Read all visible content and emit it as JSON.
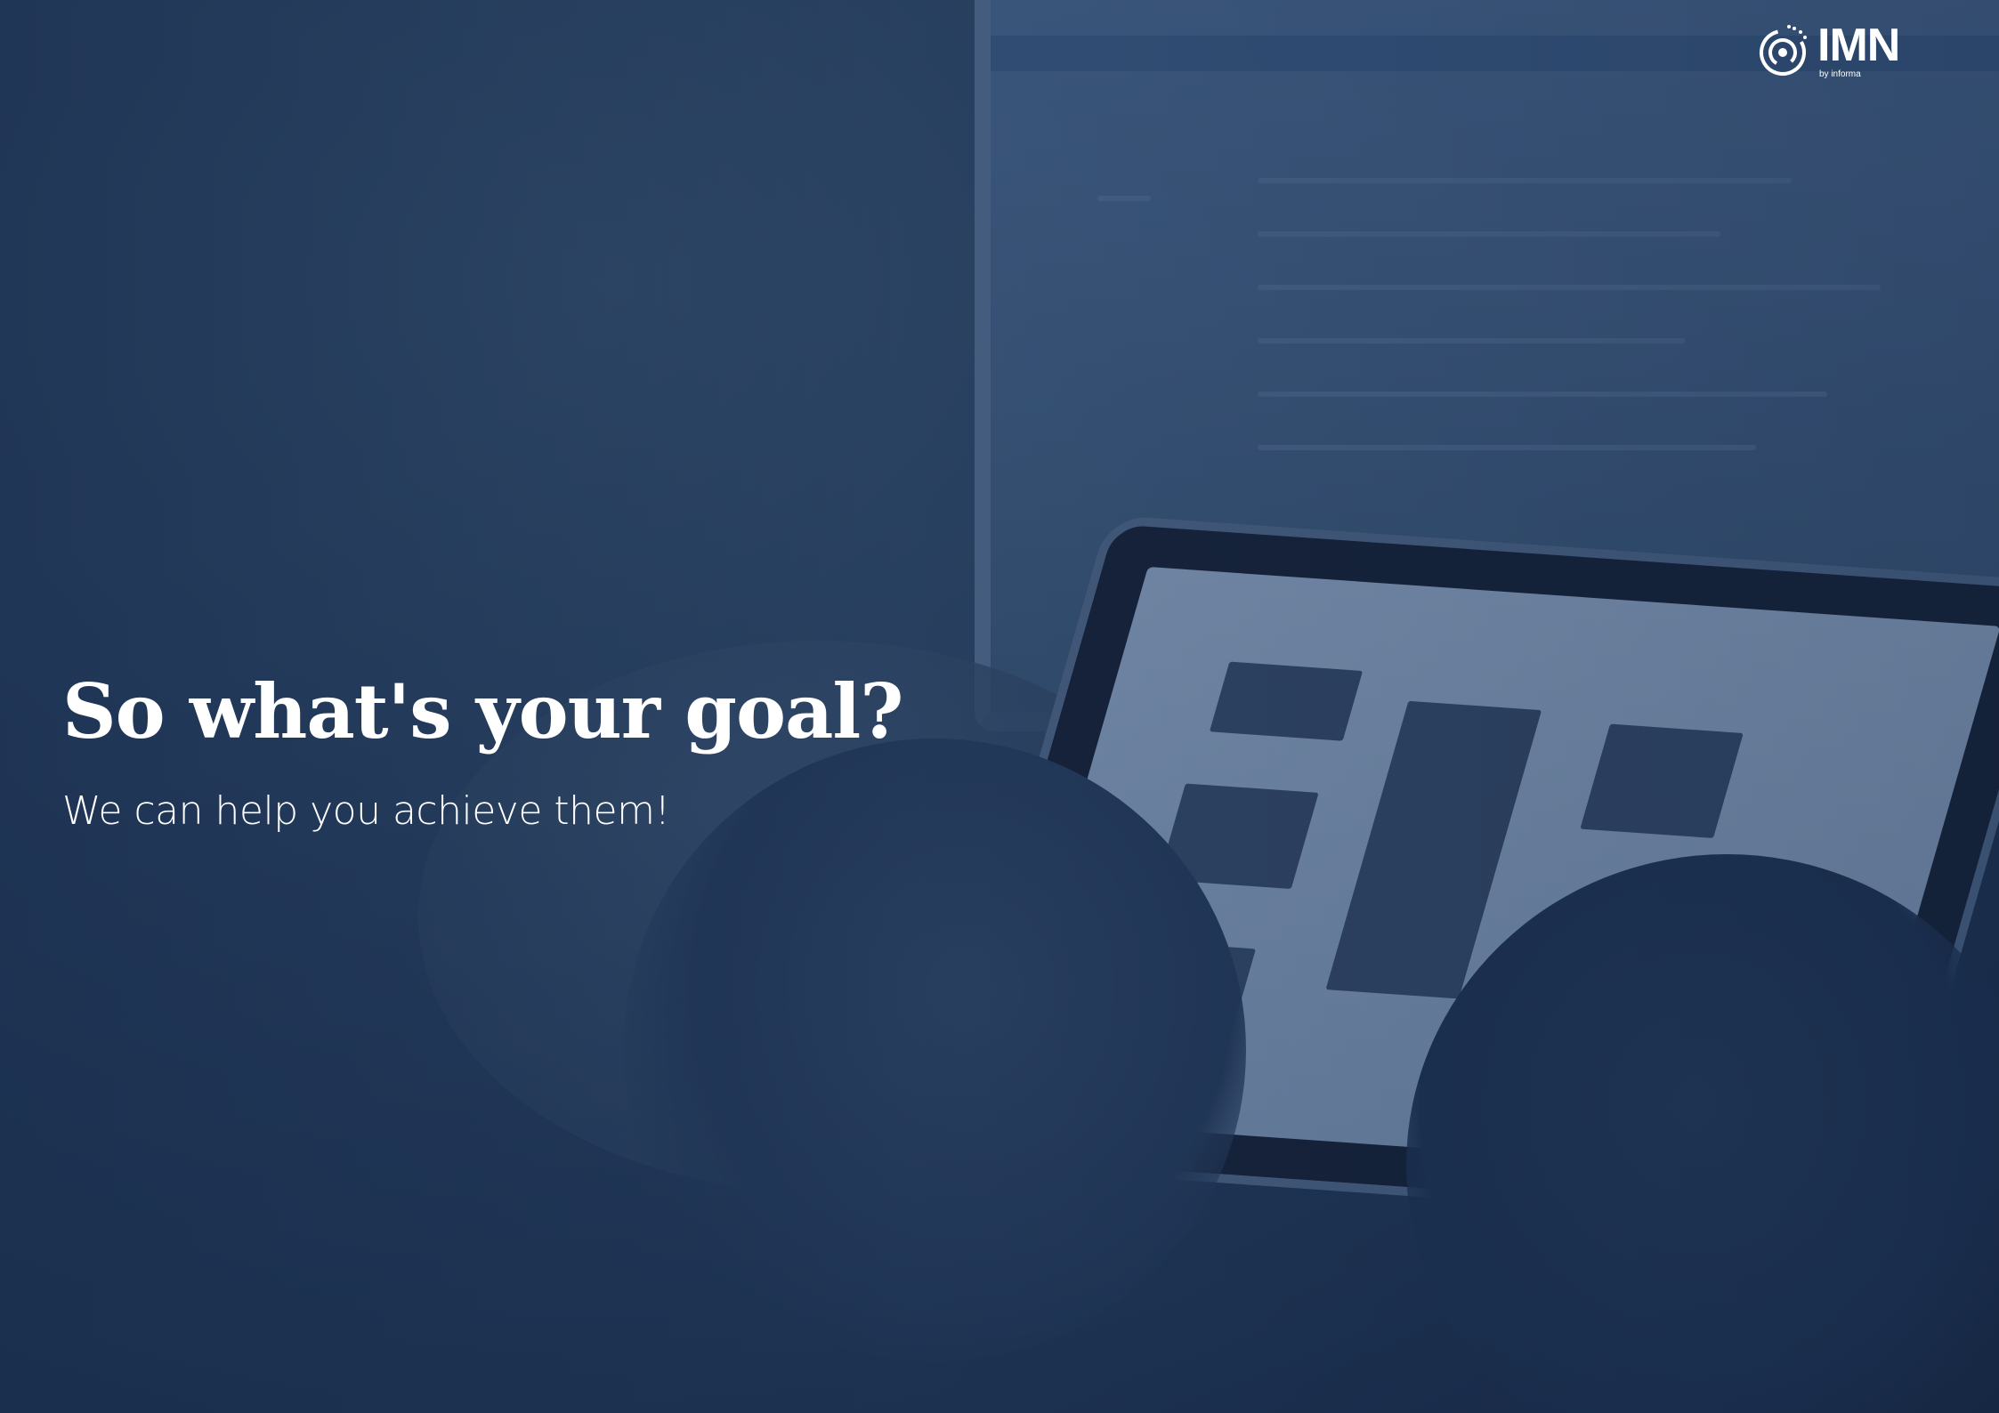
{
  "logo": {
    "name": "IMN",
    "byline": "by informa",
    "icon": "imn-ring-icon"
  },
  "hero": {
    "title": "So what's your goal?",
    "subtitle": "We can help you achieve them!"
  },
  "colors": {
    "background": "#1f3556",
    "text": "#ffffff"
  }
}
